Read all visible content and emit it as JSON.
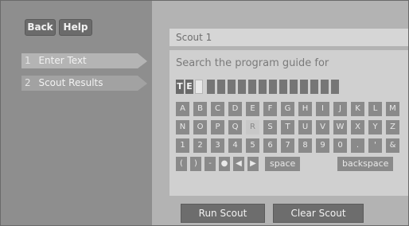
{
  "header": {
    "back_label": "Back",
    "help_label": "Help"
  },
  "steps": [
    {
      "number": "1",
      "label": "Enter Text"
    },
    {
      "number": "2",
      "label": "Scout Results"
    }
  ],
  "panel": {
    "title": "Scout 1",
    "prompt": "Search the program guide for",
    "entered_text": [
      "T",
      "E"
    ]
  },
  "keyboard": {
    "row1": [
      "A",
      "B",
      "C",
      "D",
      "E",
      "F",
      "G",
      "H",
      "I",
      "J",
      "K",
      "L",
      "M"
    ],
    "row2": [
      "N",
      "O",
      "P",
      "Q",
      "R",
      "S",
      "T",
      "U",
      "V",
      "W",
      "X",
      "Y",
      "Z"
    ],
    "row3": [
      "1",
      "2",
      "3",
      "4",
      "5",
      "6",
      "7",
      "8",
      "9",
      "0",
      ".",
      "'",
      "&"
    ],
    "row4": [
      "(",
      ")",
      "-",
      "●",
      "◀",
      "▶"
    ],
    "space_label": "space",
    "backspace_label": "backspace",
    "selected_key": "R"
  },
  "actions": {
    "run_label": "Run Scout",
    "clear_label": "Clear Scout"
  }
}
